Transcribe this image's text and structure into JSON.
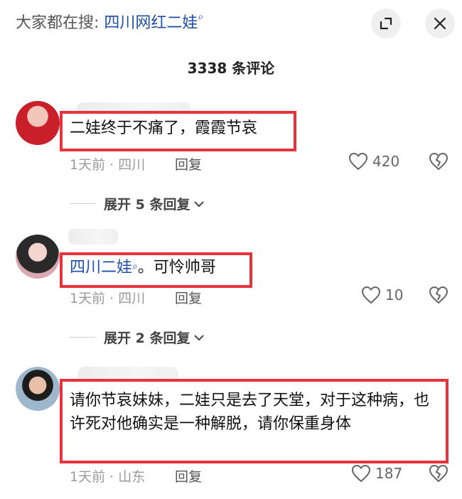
{
  "header": {
    "search_prefix": "大家都在搜:",
    "search_term": "四川网红二娃"
  },
  "comment_count": "3338 条评论",
  "comments": [
    {
      "text": "二娃终于不痛了，霞霞节哀",
      "meta": "1天前 · 四川",
      "reply_label": "回复",
      "likes": "420",
      "expand_label": "展开 5 条回复"
    },
    {
      "text_link": "四川二娃",
      "text_rest": "。可怜帅哥",
      "meta": "1天前 · 四川",
      "reply_label": "回复",
      "likes": "10",
      "expand_label": "展开 2 条回复"
    },
    {
      "text": "请你节哀妹妹，二娃只是去了天堂，对于这种病，也许死对他确实是一种解脱，请你保重身体",
      "meta": "1天前 · 山东",
      "reply_label": "回复",
      "likes": "187"
    }
  ],
  "colors": {
    "highlight_border": "#e8323c",
    "link": "#1f4fa6"
  }
}
